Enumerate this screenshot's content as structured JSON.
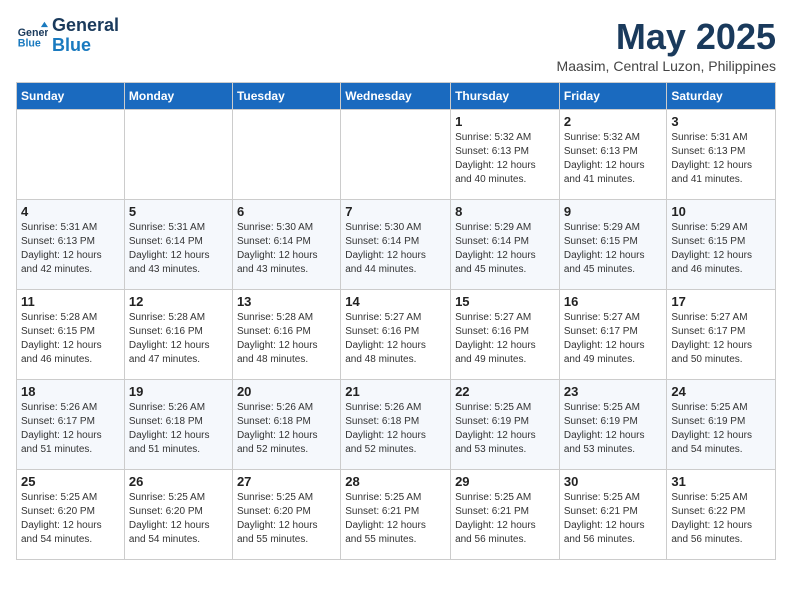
{
  "logo": {
    "line1": "General",
    "line2": "Blue"
  },
  "header": {
    "month": "May 2025",
    "location": "Maasim, Central Luzon, Philippines"
  },
  "weekdays": [
    "Sunday",
    "Monday",
    "Tuesday",
    "Wednesday",
    "Thursday",
    "Friday",
    "Saturday"
  ],
  "weeks": [
    [
      {
        "day": "",
        "info": ""
      },
      {
        "day": "",
        "info": ""
      },
      {
        "day": "",
        "info": ""
      },
      {
        "day": "",
        "info": ""
      },
      {
        "day": "1",
        "info": "Sunrise: 5:32 AM\nSunset: 6:13 PM\nDaylight: 12 hours\nand 40 minutes."
      },
      {
        "day": "2",
        "info": "Sunrise: 5:32 AM\nSunset: 6:13 PM\nDaylight: 12 hours\nand 41 minutes."
      },
      {
        "day": "3",
        "info": "Sunrise: 5:31 AM\nSunset: 6:13 PM\nDaylight: 12 hours\nand 41 minutes."
      }
    ],
    [
      {
        "day": "4",
        "info": "Sunrise: 5:31 AM\nSunset: 6:13 PM\nDaylight: 12 hours\nand 42 minutes."
      },
      {
        "day": "5",
        "info": "Sunrise: 5:31 AM\nSunset: 6:14 PM\nDaylight: 12 hours\nand 43 minutes."
      },
      {
        "day": "6",
        "info": "Sunrise: 5:30 AM\nSunset: 6:14 PM\nDaylight: 12 hours\nand 43 minutes."
      },
      {
        "day": "7",
        "info": "Sunrise: 5:30 AM\nSunset: 6:14 PM\nDaylight: 12 hours\nand 44 minutes."
      },
      {
        "day": "8",
        "info": "Sunrise: 5:29 AM\nSunset: 6:14 PM\nDaylight: 12 hours\nand 45 minutes."
      },
      {
        "day": "9",
        "info": "Sunrise: 5:29 AM\nSunset: 6:15 PM\nDaylight: 12 hours\nand 45 minutes."
      },
      {
        "day": "10",
        "info": "Sunrise: 5:29 AM\nSunset: 6:15 PM\nDaylight: 12 hours\nand 46 minutes."
      }
    ],
    [
      {
        "day": "11",
        "info": "Sunrise: 5:28 AM\nSunset: 6:15 PM\nDaylight: 12 hours\nand 46 minutes."
      },
      {
        "day": "12",
        "info": "Sunrise: 5:28 AM\nSunset: 6:16 PM\nDaylight: 12 hours\nand 47 minutes."
      },
      {
        "day": "13",
        "info": "Sunrise: 5:28 AM\nSunset: 6:16 PM\nDaylight: 12 hours\nand 48 minutes."
      },
      {
        "day": "14",
        "info": "Sunrise: 5:27 AM\nSunset: 6:16 PM\nDaylight: 12 hours\nand 48 minutes."
      },
      {
        "day": "15",
        "info": "Sunrise: 5:27 AM\nSunset: 6:16 PM\nDaylight: 12 hours\nand 49 minutes."
      },
      {
        "day": "16",
        "info": "Sunrise: 5:27 AM\nSunset: 6:17 PM\nDaylight: 12 hours\nand 49 minutes."
      },
      {
        "day": "17",
        "info": "Sunrise: 5:27 AM\nSunset: 6:17 PM\nDaylight: 12 hours\nand 50 minutes."
      }
    ],
    [
      {
        "day": "18",
        "info": "Sunrise: 5:26 AM\nSunset: 6:17 PM\nDaylight: 12 hours\nand 51 minutes."
      },
      {
        "day": "19",
        "info": "Sunrise: 5:26 AM\nSunset: 6:18 PM\nDaylight: 12 hours\nand 51 minutes."
      },
      {
        "day": "20",
        "info": "Sunrise: 5:26 AM\nSunset: 6:18 PM\nDaylight: 12 hours\nand 52 minutes."
      },
      {
        "day": "21",
        "info": "Sunrise: 5:26 AM\nSunset: 6:18 PM\nDaylight: 12 hours\nand 52 minutes."
      },
      {
        "day": "22",
        "info": "Sunrise: 5:25 AM\nSunset: 6:19 PM\nDaylight: 12 hours\nand 53 minutes."
      },
      {
        "day": "23",
        "info": "Sunrise: 5:25 AM\nSunset: 6:19 PM\nDaylight: 12 hours\nand 53 minutes."
      },
      {
        "day": "24",
        "info": "Sunrise: 5:25 AM\nSunset: 6:19 PM\nDaylight: 12 hours\nand 54 minutes."
      }
    ],
    [
      {
        "day": "25",
        "info": "Sunrise: 5:25 AM\nSunset: 6:20 PM\nDaylight: 12 hours\nand 54 minutes."
      },
      {
        "day": "26",
        "info": "Sunrise: 5:25 AM\nSunset: 6:20 PM\nDaylight: 12 hours\nand 54 minutes."
      },
      {
        "day": "27",
        "info": "Sunrise: 5:25 AM\nSunset: 6:20 PM\nDaylight: 12 hours\nand 55 minutes."
      },
      {
        "day": "28",
        "info": "Sunrise: 5:25 AM\nSunset: 6:21 PM\nDaylight: 12 hours\nand 55 minutes."
      },
      {
        "day": "29",
        "info": "Sunrise: 5:25 AM\nSunset: 6:21 PM\nDaylight: 12 hours\nand 56 minutes."
      },
      {
        "day": "30",
        "info": "Sunrise: 5:25 AM\nSunset: 6:21 PM\nDaylight: 12 hours\nand 56 minutes."
      },
      {
        "day": "31",
        "info": "Sunrise: 5:25 AM\nSunset: 6:22 PM\nDaylight: 12 hours\nand 56 minutes."
      }
    ]
  ]
}
